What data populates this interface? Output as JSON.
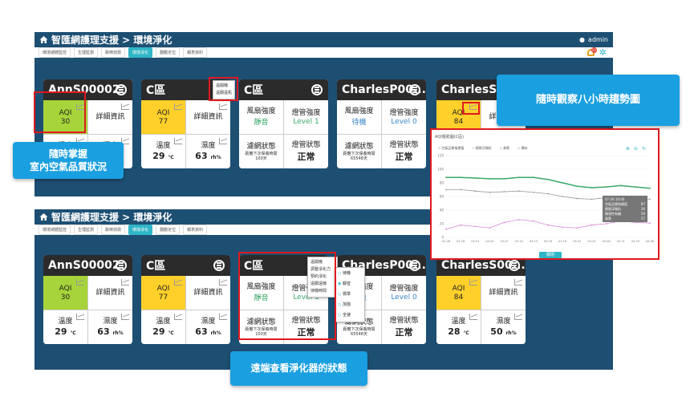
{
  "app": {
    "title": "智匯網護理支援 > 環境淨化",
    "user": "admin",
    "notifications": "13"
  },
  "tabs": [
    "環境總體監控",
    "生理監測",
    "跌倒偵測",
    "環境淨化",
    "翻動定位",
    "報表資料"
  ],
  "cards_top": [
    {
      "name": "AnnS00002",
      "aqi_label": "AQI",
      "aqi": "30",
      "aqi_color": "#a7d43a",
      "detail": "詳細資訊",
      "temp_label": "溫度",
      "temp": "29",
      "temp_unit": "℃",
      "hum_label": "濕度",
      "hum": "63",
      "hum_unit": "rh%"
    },
    {
      "name": "C區",
      "aqi_label": "AQI",
      "aqi": "77",
      "aqi_color": "#ffd02a",
      "detail": "詳細資訊",
      "temp_label": "溫度",
      "temp": "29",
      "temp_unit": "℃",
      "hum_label": "濕度",
      "hum": "63",
      "hum_unit": "rh%"
    },
    {
      "name": "C區",
      "fan_label": "風扇強度",
      "fan": "靜音",
      "lamp_label": "燈管強度",
      "lamp": "Level 1",
      "filter_label": "濾網狀態",
      "filter_text": "距離下次保養時間",
      "filter_val": "100天",
      "lampstat_label": "燈管狀態",
      "lampstat": "正常"
    },
    {
      "name": "CharlesP00...",
      "fan_label": "風扇強度",
      "fan": "待機",
      "lamp_label": "燈管強度",
      "lamp": "Level 0",
      "filter_label": "濾網狀態",
      "filter_text": "距離下次保養時間",
      "filter_val": "65548天",
      "lampstat_label": "燈管狀態",
      "lampstat": "正常"
    },
    {
      "name": "CharlesS00...",
      "aqi_label": "AQI",
      "aqi": "84",
      "aqi_color": "#ffd02a",
      "detail": "詳細資訊",
      "temp_label": "溫度",
      "temp": "28",
      "temp_unit": "℃",
      "hum_label": "濕度",
      "hum": "50",
      "hum_unit": "rh%"
    }
  ],
  "cards_bottom": [
    {
      "name": "AnnS00002",
      "aqi_label": "AQI",
      "aqi": "30",
      "aqi_color": "#a7d43a",
      "detail": "詳細資訊",
      "temp_label": "溫度",
      "temp": "29",
      "temp_unit": "℃",
      "hum_label": "濕度",
      "hum": "63",
      "hum_unit": "rh%"
    },
    {
      "name": "C區",
      "aqi_label": "AQI",
      "aqi": "77",
      "aqi_color": "#ffd02a",
      "detail": "詳細資訊",
      "temp_label": "溫度",
      "temp": "29",
      "temp_unit": "℃",
      "hum_label": "濕度",
      "hum": "63",
      "hum_unit": "rh%"
    },
    {
      "name": "C區",
      "fan_label": "風扇強度",
      "fan": "靜音",
      "lamp_label": "燈管強度",
      "lamp": "Level 1",
      "filter_label": "濾網狀態",
      "filter_text": "距離下次保養時間",
      "filter_val": "100天",
      "lampstat_label": "燈管狀態",
      "lampstat": "正常"
    },
    {
      "name": "CharlesP00...",
      "fan_label": "風扇強度",
      "fan": "待機",
      "lamp_label": "燈管強度",
      "lamp": "Level 0",
      "filter_label": "濾網狀態",
      "filter_text": "距離下次保養時間",
      "filter_val": "65548天",
      "lampstat_label": "燈管狀態",
      "lampstat": "正常"
    },
    {
      "name": "CharlesS00...",
      "aqi_label": "AQI",
      "aqi": "84",
      "aqi_color": "#ffd02a",
      "detail": "詳細資訊",
      "temp_label": "溫度",
      "temp": "28",
      "temp_unit": "℃",
      "hum_label": "濕度",
      "hum": "50",
      "hum_unit": "rh%"
    }
  ],
  "menu_top": [
    "遠開機",
    "遠關遠机"
  ],
  "menu_bottom": [
    "遠開機",
    "調整淨化力",
    "預約淨化",
    "遠關遠機",
    "待機時間"
  ],
  "fan_options": [
    "待機",
    "靜音",
    "標準",
    "加強",
    "全速"
  ],
  "fan_selected": "靜音",
  "callouts": {
    "aqi": "隨時掌握\n室內空氣品質狀況",
    "trend": "隨時觀察八小時趨勢圖",
    "status": "遠端查看淨化器的狀態"
  },
  "chart_title": "AQI趨勢圖(C區)",
  "chart_close": "關閉",
  "chart_data": {
    "type": "line",
    "title": "AQI趨勢圖(C區)",
    "x": [
      "02-26",
      "02-28",
      "03-01",
      "03-04",
      "03-07",
      "03-10",
      "03-13",
      "03-16",
      "03-19",
      "03-22",
      "03-25",
      "03-28",
      "03-31",
      "04-03",
      "04-06"
    ],
    "xlabel": "",
    "ylabel": "",
    "ylim": [
      0,
      120
    ],
    "yticks": [
      "0",
      "20",
      "40",
      "60",
      "80",
      "100",
      "120"
    ],
    "legend": [
      "空氣品質指標值",
      "總懸浮微粒",
      "臭氧",
      "異味"
    ],
    "series": [
      {
        "name": "空氣品質指標值",
        "color": "#3aa96a",
        "values": [
          88,
          88,
          87,
          86,
          86,
          88,
          88,
          85,
          80,
          75,
          73,
          74,
          76,
          74,
          72
        ]
      },
      {
        "name": "總懸浮微粒",
        "color": "#999999",
        "values": [
          70,
          70,
          68,
          66,
          67,
          68,
          66,
          64,
          60,
          57,
          56,
          58,
          59,
          57,
          56
        ]
      },
      {
        "name": "臭氧",
        "color": "#d88ad8",
        "values": [
          12,
          18,
          16,
          14,
          22,
          26,
          24,
          18,
          15,
          14,
          18,
          20,
          24,
          22,
          21
        ]
      }
    ],
    "tooltip": {
      "time": "07-29 10:00",
      "rows": [
        [
          "空氣品質指標值",
          "87"
        ],
        [
          "總懸浮微粒",
          "36"
        ],
        [
          "揮發性有機",
          "56"
        ],
        [
          "臭氧",
          "57"
        ]
      ]
    }
  }
}
